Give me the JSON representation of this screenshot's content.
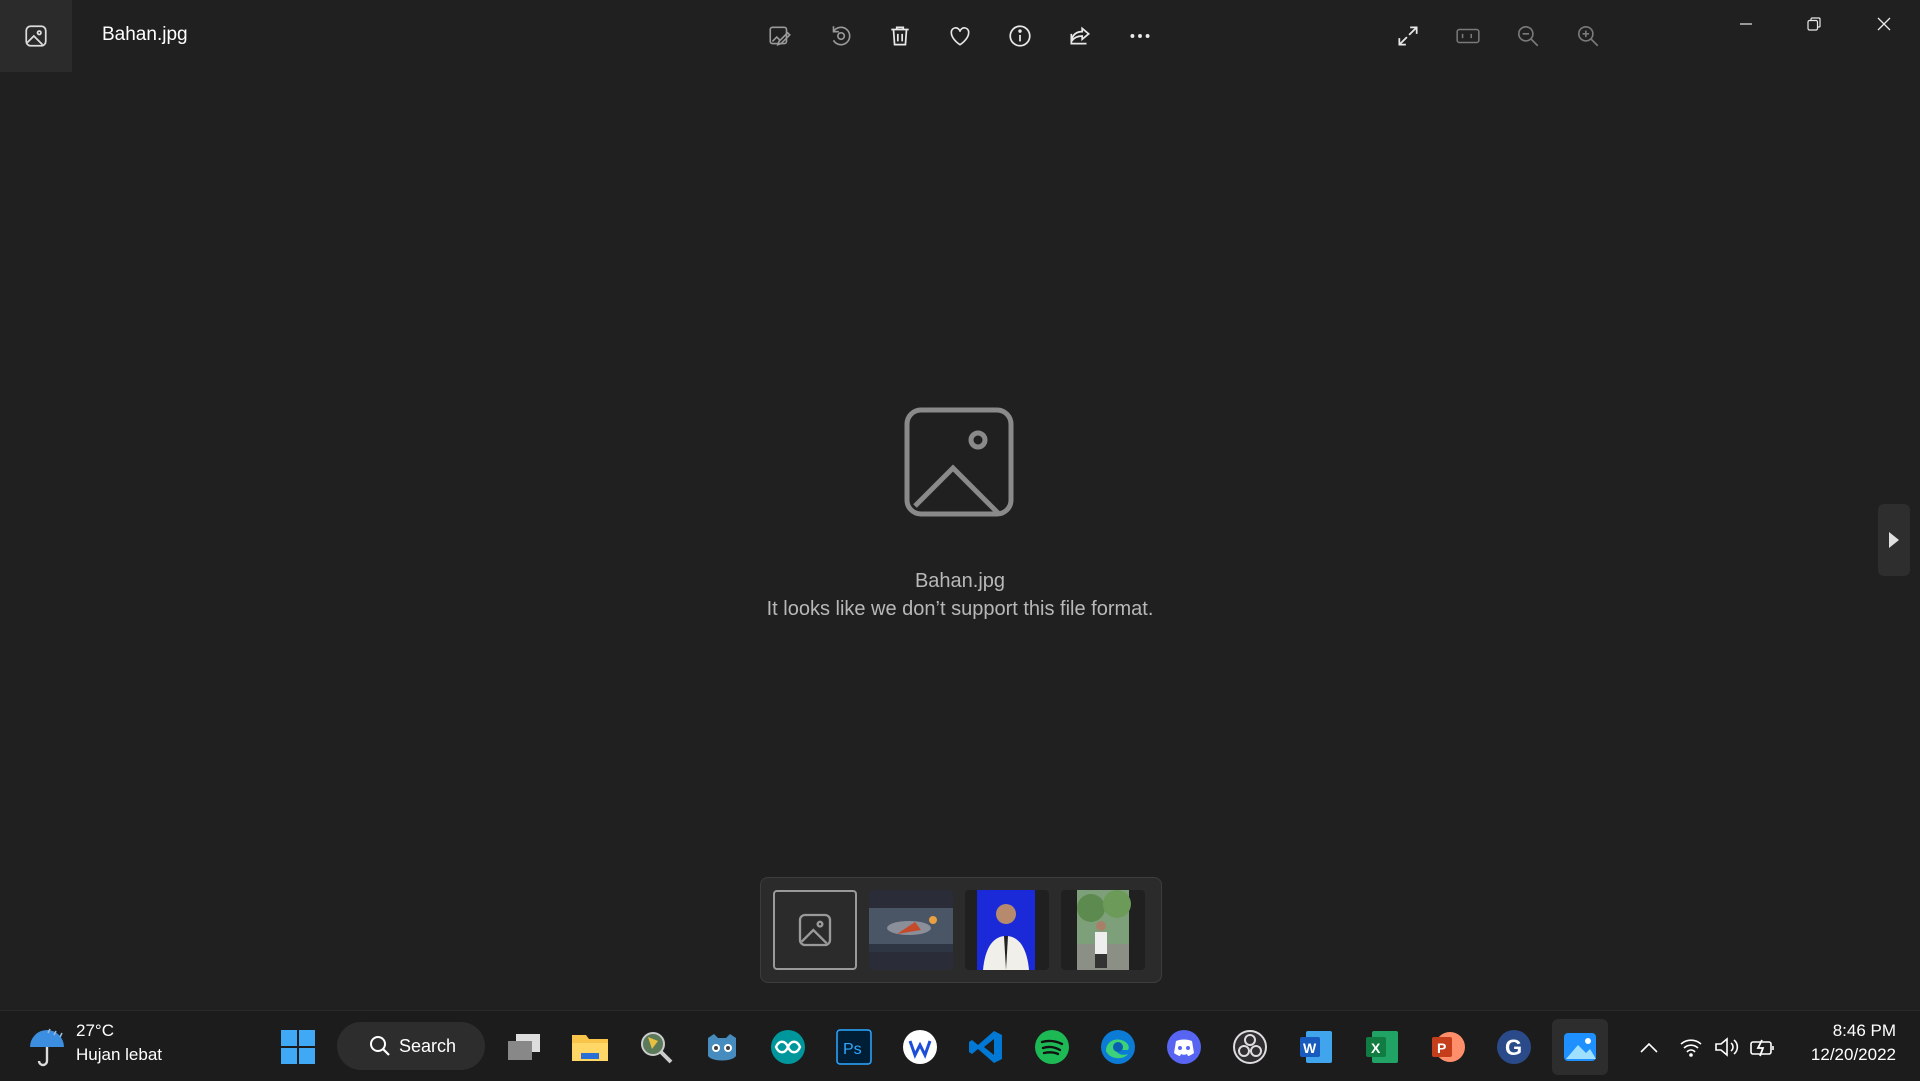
{
  "window": {
    "title": "Bahan.jpg",
    "toolbar": [
      "edit-image",
      "rotate",
      "delete",
      "favorite",
      "file-info",
      "share",
      "see-more"
    ],
    "view_controls": [
      "full-screen",
      "actual-size",
      "zoom-out",
      "zoom-in"
    ],
    "window_controls": [
      "minimize",
      "restore",
      "close"
    ]
  },
  "viewer": {
    "file_name": "Bahan.jpg",
    "message": "It looks like we don’t support this file format."
  },
  "filmstrip": {
    "selected_index": 0,
    "thumbnails": [
      "unsupported-file-icon",
      "space-battle-scene",
      "portrait-blue-background",
      "person-outdoors-trees"
    ]
  },
  "taskbar": {
    "weather": {
      "temperature": "27°C",
      "condition": "Hujan lebat",
      "icon": "umbrella-rain-icon"
    },
    "search_label": "Search",
    "apps": [
      "start",
      "task-view",
      "file-explorer",
      "magnifier-tool",
      "godot",
      "arduino",
      "photoshop",
      "wps-writer",
      "vs-code",
      "spotify",
      "edge",
      "discord",
      "obs",
      "word",
      "excel",
      "powerpoint",
      "g-app",
      "photos"
    ],
    "tray": [
      "show-hidden-icons",
      "wifi",
      "volume",
      "battery"
    ],
    "clock": {
      "time": "8:46 PM",
      "date": "12/20/2022"
    }
  },
  "colors": {
    "background": "#202020",
    "taskbar": "#1c1c1c",
    "text_muted": "#b8b8b8"
  }
}
